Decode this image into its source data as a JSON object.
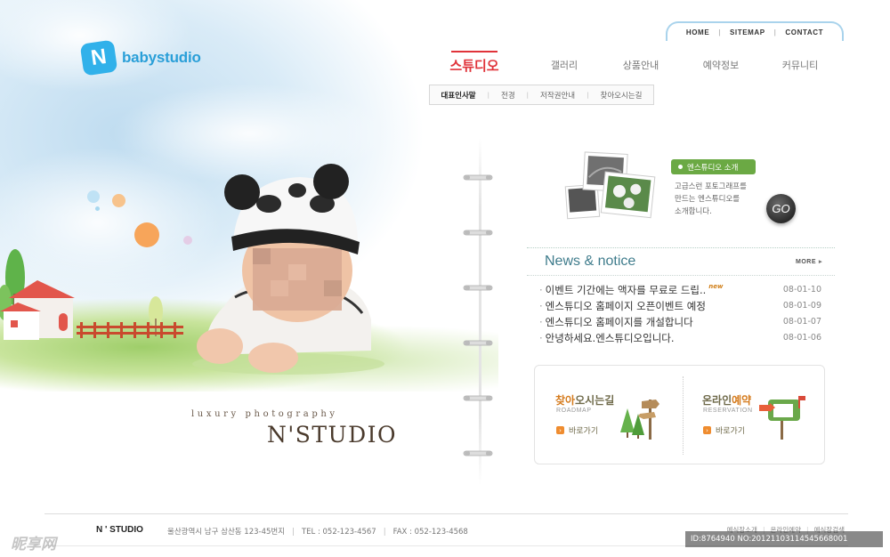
{
  "logo": {
    "badge": "N",
    "text": "babystudio"
  },
  "util_nav": [
    "HOME",
    "SITEMAP",
    "CONTACT"
  ],
  "main_nav": [
    "스튜디오",
    "갤러리",
    "상품안내",
    "예약정보",
    "커뮤니티"
  ],
  "main_nav_active": "스튜디오",
  "sub_nav": [
    "대표인사말",
    "전경",
    "저작권안내",
    "찾아오시는길"
  ],
  "sub_nav_active": "대표인사말",
  "visual": {
    "tagline": "luxury photography",
    "brand": "N'STUDIO"
  },
  "intro": {
    "label": "엔스튜디오 소개",
    "desc_line1": "고급스런 포토그래프를",
    "desc_line2": "만드는 엔스튜디오를",
    "desc_line3": "소개합니다.",
    "go": "GO"
  },
  "news": {
    "title": "News & notice",
    "more": "MORE",
    "new_badge": "new",
    "items": [
      {
        "title": "이벤트 기간에는 액자를 무료로 드립..",
        "date": "08-01-10",
        "is_new": true
      },
      {
        "title": "엔스튜디오 홈페이지 오픈이벤트 예정",
        "date": "08-01-09",
        "is_new": false
      },
      {
        "title": "엔스튜디오 홈페이지를 개설합니다",
        "date": "08-01-07",
        "is_new": false
      },
      {
        "title": "안녕하세요.엔스튜디오입니다.",
        "date": "08-01-06",
        "is_new": false
      }
    ]
  },
  "quick": {
    "roadmap": {
      "title_a": "찾아",
      "title_b": "오시는길",
      "sub": "ROADMAP",
      "link": "바로가기"
    },
    "reservation": {
      "title_a": "온라인",
      "title_b": "예약",
      "sub": "RESERVATION",
      "link": "바로가기"
    }
  },
  "footer": {
    "brand": "N ' STUDIO",
    "address": "울산광역시 남구 삼산동 123-45번지",
    "tel": "TEL : 052-123-4567",
    "fax": "FAX : 052-123-4568",
    "links": [
      "예식장소개",
      "온라인예약",
      "예식장검색"
    ]
  },
  "watermark": {
    "left": "昵享网",
    "right": "ID:8764940 NO:20121103114545668001"
  },
  "colors": {
    "accent_red": "#e0333a",
    "logo_blue": "#31b1ea",
    "intro_green": "#6ba944",
    "news_title": "#3f7c8c",
    "quick_orange": "#d57b1d"
  }
}
